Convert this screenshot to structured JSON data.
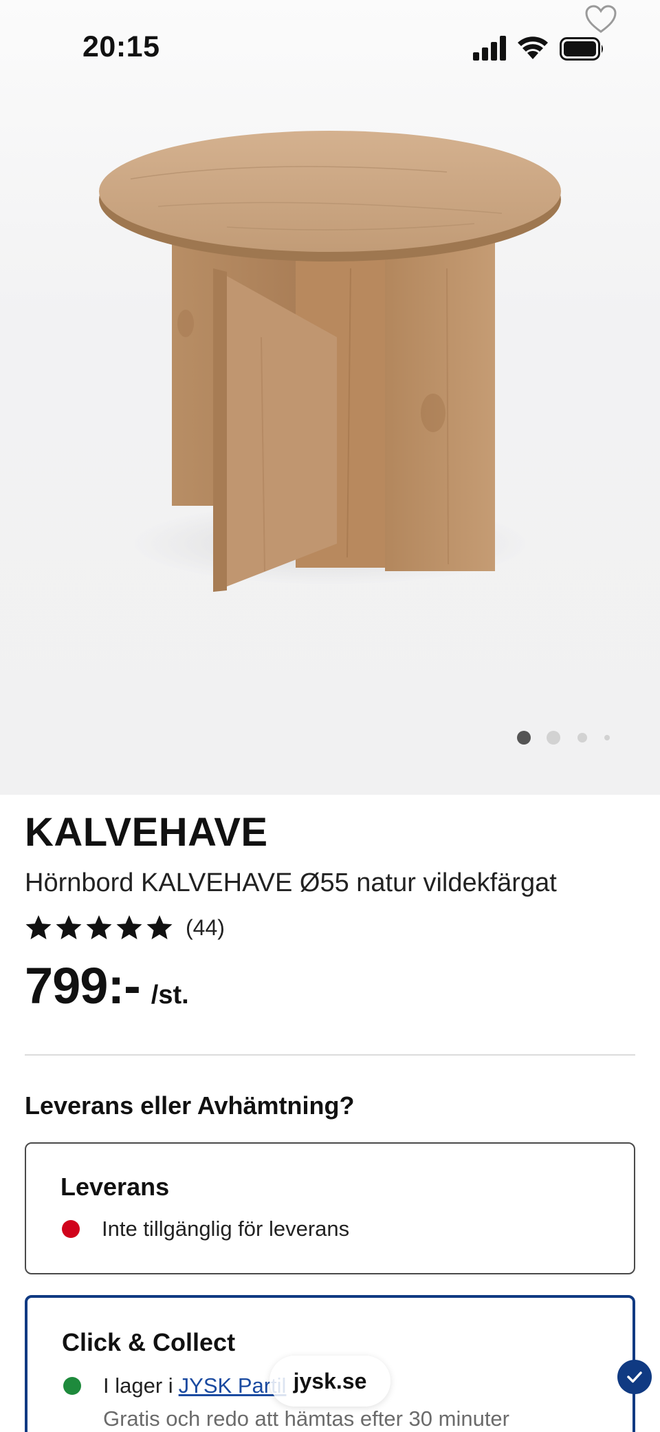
{
  "status_bar": {
    "time": "20:15"
  },
  "gallery": {
    "image_alt": "Hörnbord KALVEHAVE",
    "active_index": 0,
    "image_count": 4
  },
  "product": {
    "brand": "KALVEHAVE",
    "subtitle": "Hörnbord KALVEHAVE Ø55 natur vildekfärgat",
    "rating_stars": 5,
    "review_count": "(44)",
    "price": "799:-",
    "unit": "/st."
  },
  "fulfillment": {
    "heading": "Leverans eller Avhämtning?",
    "delivery": {
      "title": "Leverans",
      "status": "Inte tillgänglig för leverans",
      "status_color": "#d0021b"
    },
    "collect": {
      "title": "Click & Collect",
      "status_prefix": "I lager i",
      "store_name": "JYSK Partil",
      "note": "Gratis och redo att hämtas efter 30 minuter",
      "status_color": "#1e8a3c",
      "selected": true
    }
  },
  "browser": {
    "url": "jysk.se"
  },
  "colors": {
    "brand_blue": "#103a82",
    "link_blue": "#1a4aa0"
  }
}
